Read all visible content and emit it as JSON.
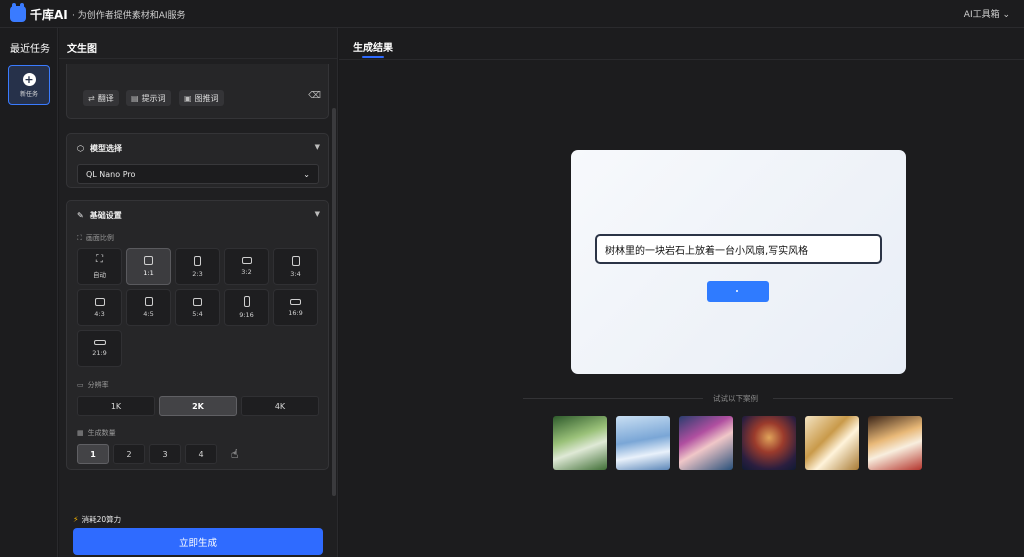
{
  "header": {
    "brand": "千库AI",
    "slogan": "· 为创作者提供素材和AI服务",
    "toolbox": "AI工具箱 ⌄"
  },
  "rail": {
    "title": "最近任务",
    "new_task": "新任务"
  },
  "panel": {
    "title": "文生图",
    "prompt_tools": {
      "translate": "翻译",
      "prompt_words": "提示词",
      "image_to_prompt": "图推词"
    },
    "model": {
      "heading": "模型选择",
      "selected": "QL Nano Pro"
    },
    "basic": {
      "heading": "基础设置",
      "ratio_label": "画面比例",
      "ratios": [
        "自动",
        "1:1",
        "2:3",
        "3:2",
        "3:4",
        "4:3",
        "4:5",
        "5:4",
        "9:16",
        "16:9",
        "21:9"
      ],
      "ratio_selected": "1:1",
      "resolution_label": "分辨率",
      "resolutions": [
        "1K",
        "2K",
        "4K"
      ],
      "resolution_selected": "2K",
      "count_label": "生成数量",
      "counts": [
        "1",
        "2",
        "3",
        "4"
      ],
      "count_selected": "1"
    },
    "cost": "消耗20算力",
    "generate": "立即生成"
  },
  "result": {
    "tab": "生成结果",
    "preview_prompt": "树林里的一块岩石上放着一台小风扇,写实风格",
    "examples_label": "试试以下案例",
    "examples": [
      "example-fantasy-creature",
      "example-winter-landscape",
      "example-cyber-girl",
      "example-neon-portrait",
      "example-gold-jewelry",
      "example-dessert"
    ]
  },
  "colors": {
    "accent": "#2f6bff",
    "bg": "#1c1c1e"
  }
}
